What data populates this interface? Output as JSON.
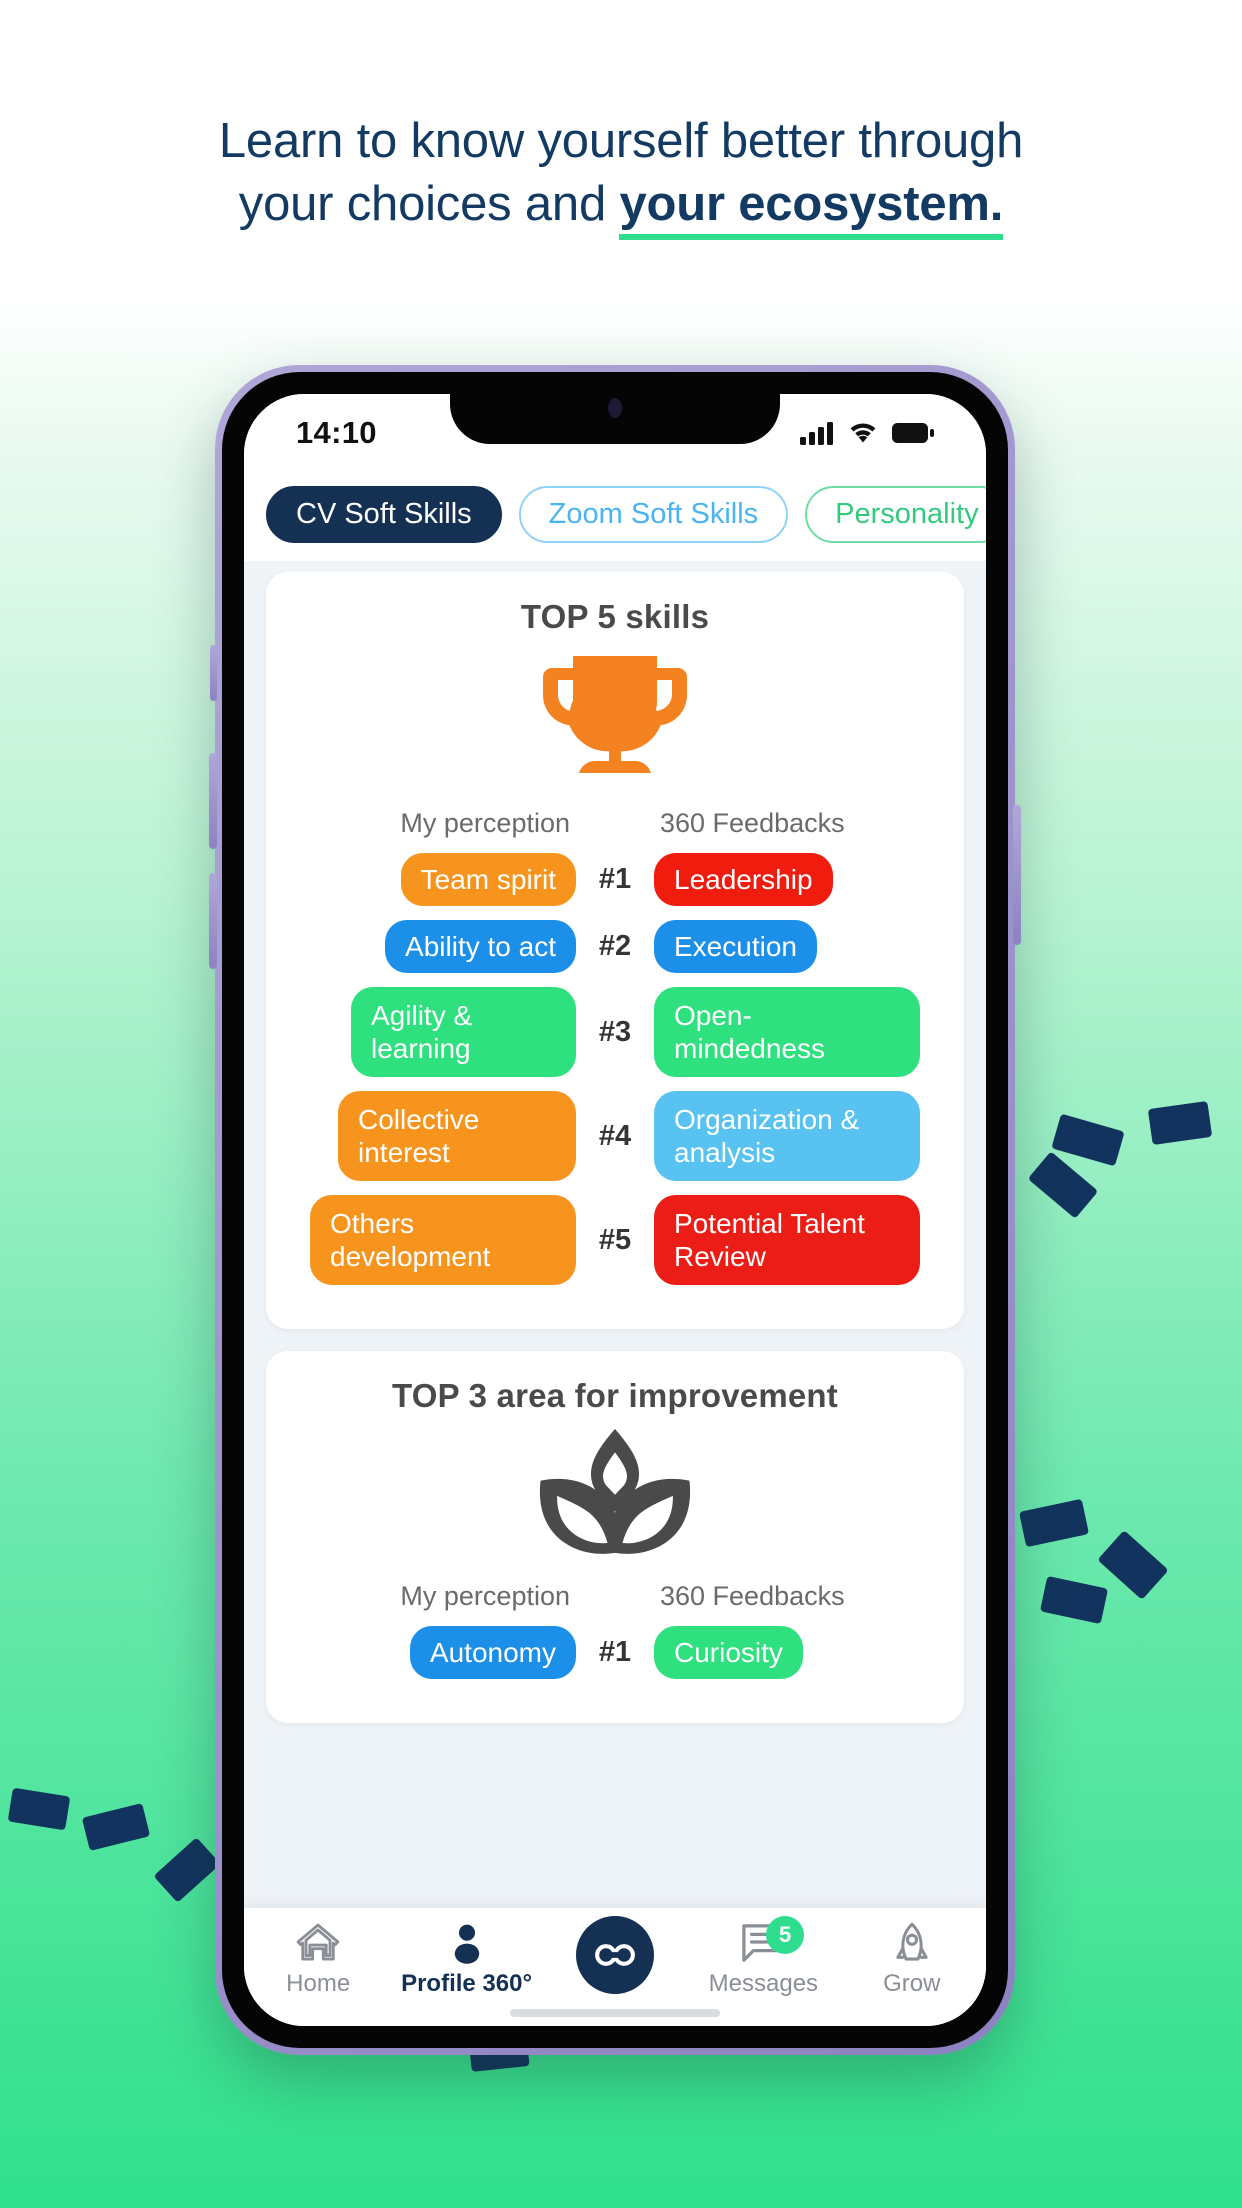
{
  "promo": {
    "headline_line1": "Learn to know yourself better through",
    "headline_line2_plain": "your choices and ",
    "headline_line2_bold": "your ecosystem.",
    "accent_green": "#2fdd8f",
    "headline_color": "#123A63"
  },
  "statusbar": {
    "time": "14:10",
    "signal_icon": "cellular-signal-icon",
    "wifi_icon": "wifi-icon",
    "battery_icon": "battery-icon"
  },
  "tabs": [
    {
      "label": "CV Soft Skills",
      "state": "selected",
      "style": "filled-navy"
    },
    {
      "label": "Zoom Soft Skills",
      "state": "unselected",
      "style": "outline-blue"
    },
    {
      "label": "Personality",
      "state": "unselected",
      "style": "outline-green"
    }
  ],
  "cards": [
    {
      "title": "TOP 5 skills",
      "icon": "trophy-icon",
      "icon_color": "#F58220",
      "col_left_header": "My perception",
      "col_right_header": "360 Feedbacks",
      "rows": [
        {
          "rank": "#1",
          "left": "Team spirit",
          "left_color": "#F7941D",
          "right": "Leadership",
          "right_color": "#F01C0E"
        },
        {
          "rank": "#2",
          "left": "Ability to act",
          "left_color": "#1C8FE8",
          "right": "Execution",
          "right_color": "#1C8FE8"
        },
        {
          "rank": "#3",
          "left": "Agility & learning",
          "left_color": "#2FE07F",
          "right": "Open-mindedness",
          "right_color": "#2FE07F"
        },
        {
          "rank": "#4",
          "left": "Collective interest",
          "left_color": "#F7941D",
          "right": "Organization & analysis",
          "right_color": "#58C3F0"
        },
        {
          "rank": "#5",
          "left": "Others development",
          "left_color": "#F7941D",
          "right": "Potential Talent Review",
          "right_color": "#EC1C16"
        }
      ]
    },
    {
      "title": "TOP 3 area for improvement",
      "icon": "lotus-icon",
      "icon_color": "#4A4A4A",
      "col_left_header": "My perception",
      "col_right_header": "360 Feedbacks",
      "rows": [
        {
          "rank": "#1",
          "left": "Autonomy",
          "left_color": "#1C8FE8",
          "right": "Curiosity",
          "right_color": "#2FE07F"
        }
      ]
    }
  ],
  "bottomnav": [
    {
      "label": "Home",
      "icon": "home-icon",
      "active": false
    },
    {
      "label": "Profile 360°",
      "icon": "person-icon",
      "active": true
    },
    {
      "label": "",
      "icon": "link-icon",
      "active": false
    },
    {
      "label": "Messages",
      "icon": "messages-icon",
      "active": false,
      "badge": "5"
    },
    {
      "label": "Grow",
      "icon": "rocket-icon",
      "active": false
    }
  ]
}
